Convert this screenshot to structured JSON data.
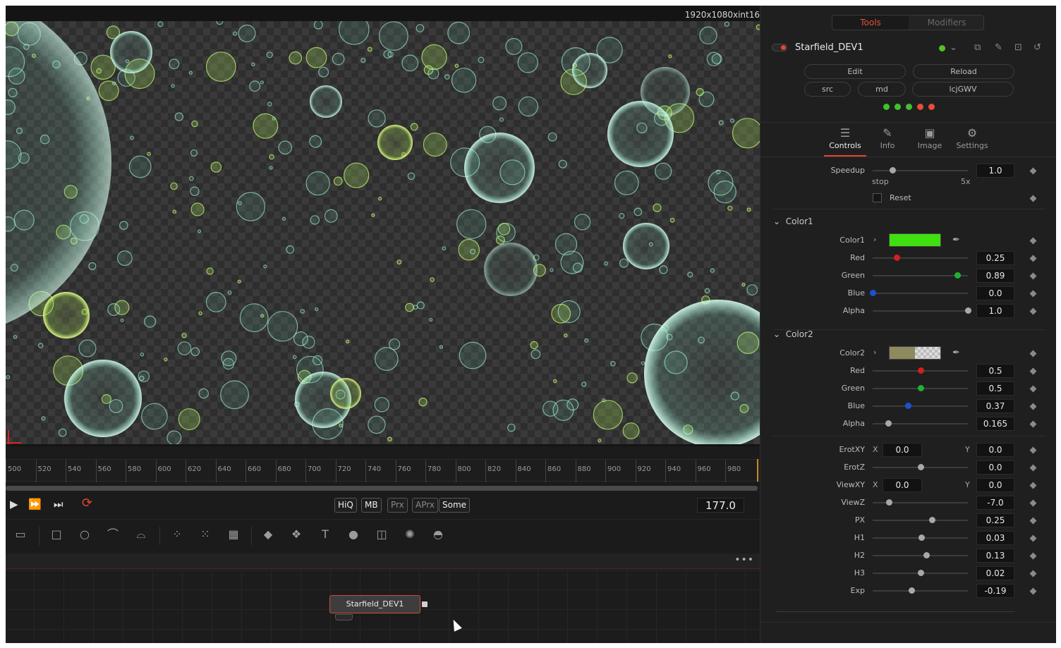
{
  "viewer": {
    "resolution": "1920x1080xint16"
  },
  "timeline": {
    "ticks": [
      "500",
      "520",
      "540",
      "560",
      "580",
      "600",
      "620",
      "640",
      "660",
      "680",
      "700",
      "720",
      "740",
      "760",
      "780",
      "800",
      "820",
      "840",
      "860",
      "880",
      "900",
      "920",
      "940",
      "960",
      "980"
    ],
    "current_frame": "177.0"
  },
  "transport": {
    "play": "▶",
    "ffwd": "⏩",
    "end": "⏭",
    "loop": "⟳",
    "quality": [
      "HiQ",
      "MB",
      "Prx",
      "APrx",
      "Some"
    ]
  },
  "toolbar": {
    "icons": [
      "background-icon",
      "rectangle-icon",
      "ellipse-icon",
      "polygon-icon",
      "bspline-icon",
      "particle-emitter-icon",
      "particle-force-icon",
      "particle-render-icon",
      "shape3d-icon",
      "merge3d-icon",
      "text3d-icon",
      "camera3d-icon",
      "renderer3d-icon",
      "light-icon",
      "image-plane-icon"
    ]
  },
  "flow": {
    "more": "•••",
    "node_label": "Starfield_DEV1"
  },
  "inspector": {
    "tabs": {
      "tools": "Tools",
      "modifiers": "Modifiers"
    },
    "tool_name": "Starfield_DEV1",
    "buttons": {
      "edit": "Edit",
      "reload": "Reload",
      "src": "src",
      "md": "md",
      "lcjgwv": "lcjGWV"
    },
    "leds": [
      "#3fc22d",
      "#3fc22d",
      "#3fc22d",
      "#e84c3a",
      "#e84c3a"
    ],
    "panel_tabs": [
      "Controls",
      "Info",
      "Image",
      "Settings"
    ],
    "speedup": {
      "label": "Speedup",
      "value": "1.0",
      "min_label": "stop",
      "max_label": "5x",
      "pos": 0.21
    },
    "reset": {
      "label": "Reset"
    },
    "color1": {
      "title": "Color1",
      "swatch_label": "Color1",
      "swatch": "#40e010",
      "channels": [
        {
          "label": "Red",
          "value": "0.25",
          "color": "#d02020",
          "pos": 0.25
        },
        {
          "label": "Green",
          "value": "0.89",
          "color": "#20b030",
          "pos": 0.89
        },
        {
          "label": "Blue",
          "value": "0.0",
          "color": "#2050d0",
          "pos": 0.0
        },
        {
          "label": "Alpha",
          "value": "1.0",
          "color": "#a8a8a8",
          "pos": 1.0
        }
      ]
    },
    "color2": {
      "title": "Color2",
      "swatch_label": "Color2",
      "swatch": "#8c8a5e",
      "channels": [
        {
          "label": "Red",
          "value": "0.5",
          "color": "#d02020",
          "pos": 0.5
        },
        {
          "label": "Green",
          "value": "0.5",
          "color": "#20b030",
          "pos": 0.5
        },
        {
          "label": "Blue",
          "value": "0.37",
          "color": "#2050d0",
          "pos": 0.37
        },
        {
          "label": "Alpha",
          "value": "0.165",
          "color": "#a8a8a8",
          "pos": 0.165
        }
      ]
    },
    "erotxy": {
      "label": "ErotXY",
      "x": "X",
      "x_value": "0.0",
      "y": "Y",
      "y_value": "0.0"
    },
    "params": [
      {
        "label": "ErotZ",
        "value": "0.0",
        "pos": 0.5
      },
      {
        "label": "ViewXY",
        "xy": true,
        "x": "X",
        "x_value": "0.0",
        "y": "Y",
        "y_value": "0.0"
      },
      {
        "label": "ViewZ",
        "value": "-7.0",
        "pos": 0.17
      },
      {
        "label": "PX",
        "value": "0.25",
        "pos": 0.62
      },
      {
        "label": "H1",
        "value": "0.03",
        "pos": 0.51
      },
      {
        "label": "H2",
        "value": "0.13",
        "pos": 0.56
      },
      {
        "label": "H3",
        "value": "0.02",
        "pos": 0.5
      },
      {
        "label": "Exp",
        "value": "-0.19",
        "pos": 0.41
      }
    ]
  }
}
